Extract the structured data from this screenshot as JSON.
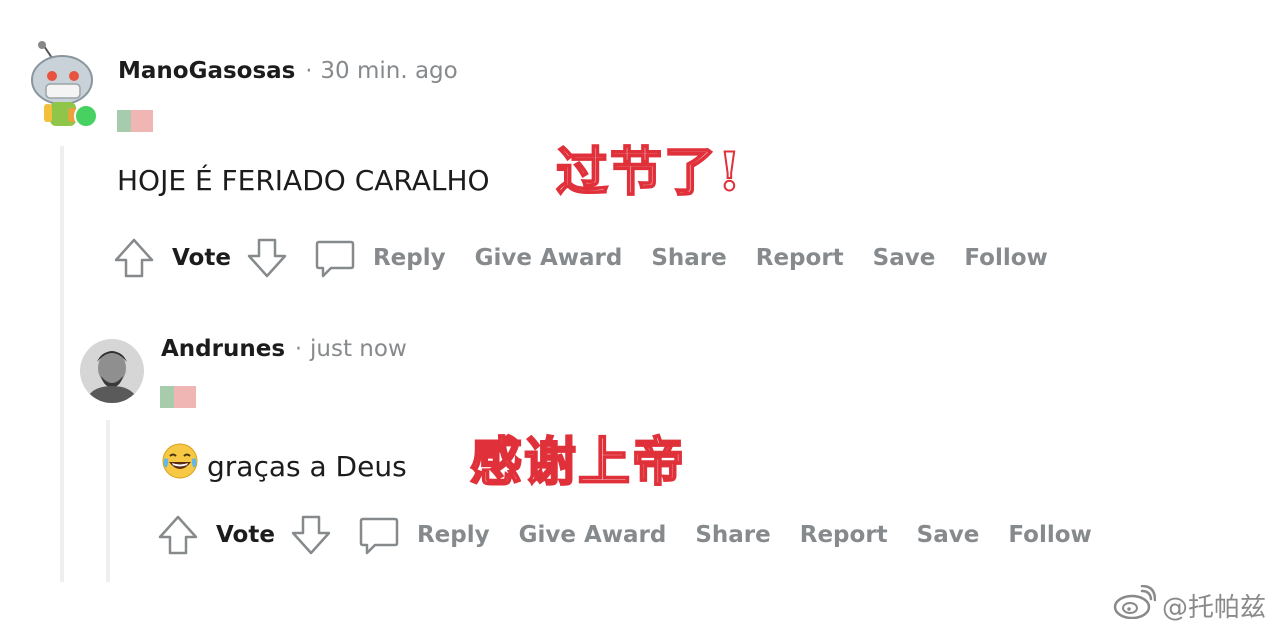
{
  "comments": [
    {
      "username": "ManoGasosas",
      "separator": "·",
      "timestamp": "30 min. ago",
      "text": "HOJE É FERIADO CARALHO",
      "annotation": "过节了!",
      "actions": {
        "vote": "Vote",
        "reply": "Reply",
        "give_award": "Give Award",
        "share": "Share",
        "report": "Report",
        "save": "Save",
        "follow": "Follow"
      }
    },
    {
      "username": "Andrunes",
      "separator": "·",
      "timestamp": "just now",
      "emoji_icon": "tears-of-joy-emoji-icon",
      "text": "graças a Deus",
      "annotation": "感谢上帝",
      "actions": {
        "vote": "Vote",
        "reply": "Reply",
        "give_award": "Give Award",
        "share": "Share",
        "report": "Report",
        "save": "Save",
        "follow": "Follow"
      }
    }
  ],
  "watermark": {
    "icon": "weibo-icon",
    "text": "@托帕兹"
  },
  "colors": {
    "meta_gray": "#878a8c",
    "online_green": "#46d160",
    "annotation_red": "#e0303a"
  }
}
